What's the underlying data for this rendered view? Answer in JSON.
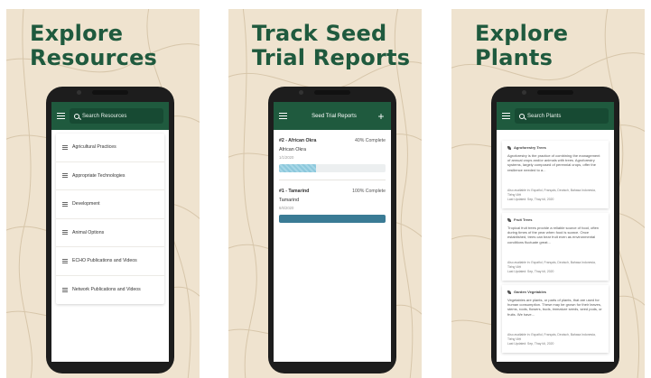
{
  "panels": [
    {
      "headline": [
        "Explore",
        "Resources"
      ],
      "search_placeholder": "Search Resources",
      "items": [
        {
          "label": "Agricultural Practices"
        },
        {
          "label": "Appropriate Technologies"
        },
        {
          "label": "Development"
        },
        {
          "label": "Animal Options"
        },
        {
          "label": "ECHO Publications and Videos"
        },
        {
          "label": "Network Publications and Videos"
        }
      ]
    },
    {
      "headline": [
        "Track Seed",
        "Trial Reports"
      ],
      "appbar_title": "Seed Trial Reports",
      "add_icon": "+",
      "reports": [
        {
          "id": "#2 - African Okra",
          "percent_label": "40% Complete",
          "progress": 0.35,
          "name": "African Okra",
          "date": "1/1/2020"
        },
        {
          "id": "#1 - Tamarind",
          "percent_label": "100% Complete",
          "progress": 1.0,
          "name": "Tamarind",
          "date": "6/6/2020"
        }
      ]
    },
    {
      "headline": [
        "Explore",
        "Plants"
      ],
      "search_placeholder": "Search Plants",
      "cards": [
        {
          "title": "Agroforestry Trees",
          "text": "Agroforestry is the practice of combining the management of annual crops and/or animals with trees. Agroforestry systems, largely composed of perennial crops, offer the resilience needed to a...",
          "meta1": "Also available in: Español, Français, Deutsch, Bahasa Indonesia, Tiếng Việt",
          "meta2": "Last Updated: Sep, Thay tôi, 2020"
        },
        {
          "title": "Fruit Trees",
          "text": "Tropical fruit trees provide a reliable source of food, often during times of the year when food is scarce. Once established, trees can bear fruit even as environmental conditions fluctuate great...",
          "meta1": "Also available in: Español, Français, Deutsch, Bahasa Indonesia, Tiếng Việt",
          "meta2": "Last Updated: Sep, Thay tôi, 2020"
        },
        {
          "title": "Garden Vegetables",
          "text": "Vegetables are plants, or parts of plants, that are used for human consumption. These may be grown for their leaves, stems, roots, flowers, buds, immature seeds, seed pods, or fruits. We have...",
          "meta1": "Also available in: Español, Français, Deutsch, Bahasa Indonesia, Tiếng Việt",
          "meta2": "Last Updated: Sep, Thay tôi, 2020"
        }
      ]
    }
  ],
  "colors": {
    "brand_green": "#1f5a3e",
    "background": "#efe3cf",
    "progress_fill": "#3a7b95",
    "progress_partial": "#8cc8dc"
  },
  "icons": [
    "menu-icon",
    "search-icon",
    "plus-icon",
    "grid-icon",
    "leaf-icon"
  ]
}
